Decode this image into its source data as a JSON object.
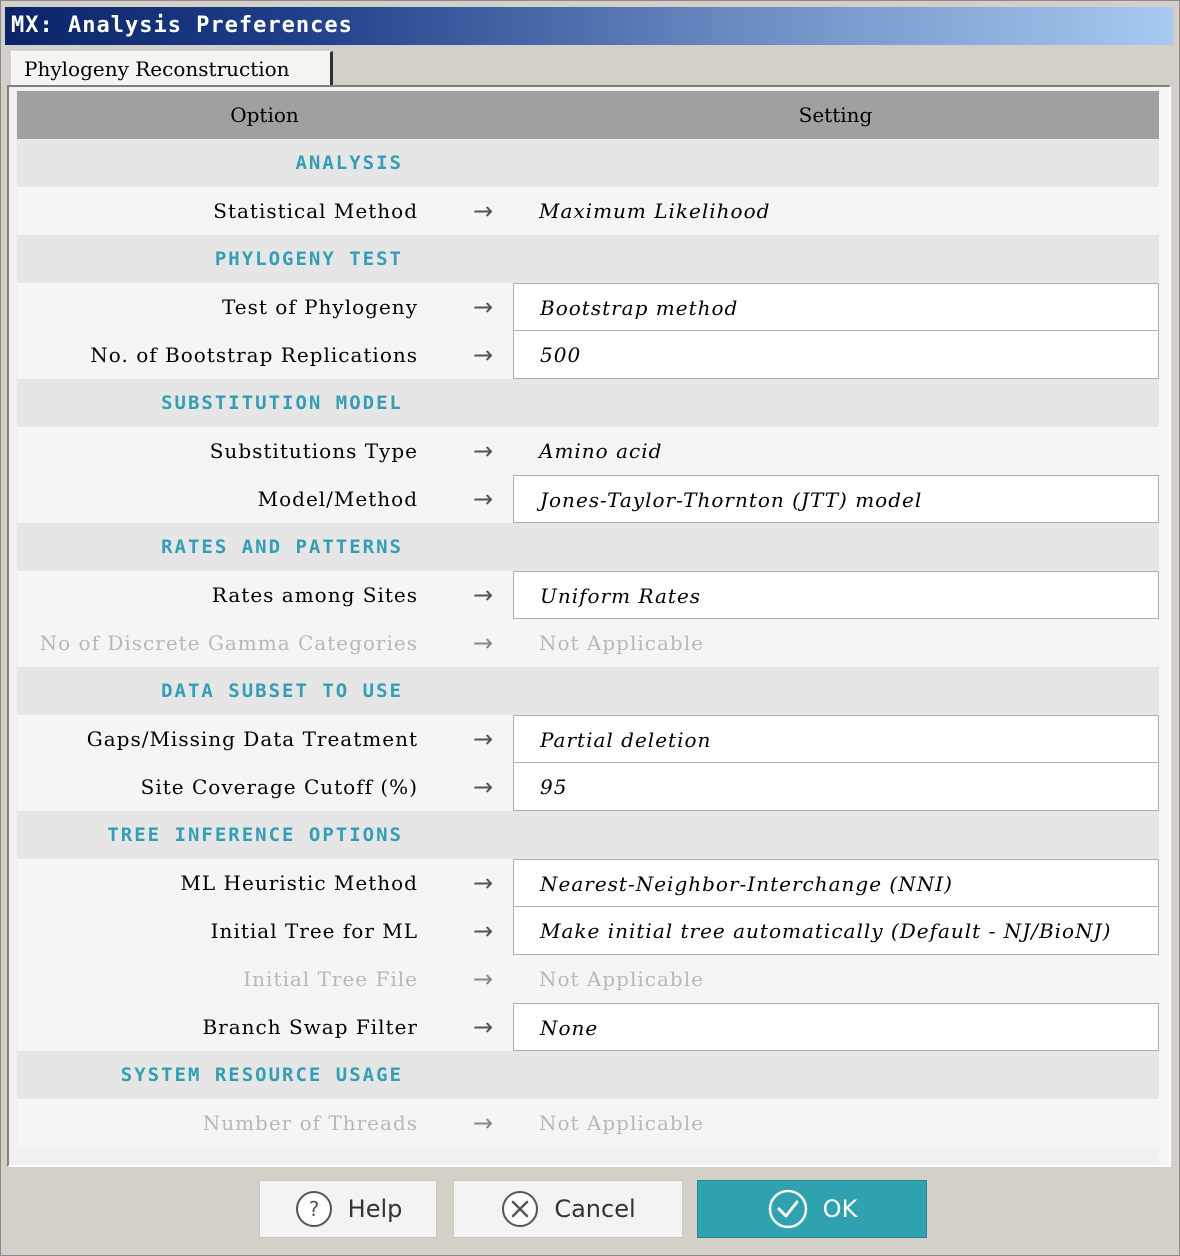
{
  "window": {
    "title": "MX: Analysis Preferences"
  },
  "tabs": [
    {
      "label": "Phylogeny Reconstruction"
    }
  ],
  "table": {
    "headers": {
      "option": "Option",
      "setting": "Setting"
    },
    "rows": [
      {
        "kind": "section",
        "label": "ANALYSIS"
      },
      {
        "kind": "item",
        "label": "Statistical Method",
        "value": "Maximum Likelihood",
        "editable": false,
        "enabled": true
      },
      {
        "kind": "section",
        "label": "PHYLOGENY TEST"
      },
      {
        "kind": "item",
        "label": "Test of Phylogeny",
        "value": "Bootstrap method",
        "editable": true,
        "enabled": true
      },
      {
        "kind": "item",
        "label": "No. of Bootstrap Replications",
        "value": "500",
        "editable": true,
        "enabled": true
      },
      {
        "kind": "section",
        "label": "SUBSTITUTION MODEL"
      },
      {
        "kind": "item",
        "label": "Substitutions Type",
        "value": "Amino acid",
        "editable": false,
        "enabled": true
      },
      {
        "kind": "item",
        "label": "Model/Method",
        "value": "Jones-Taylor-Thornton (JTT) model",
        "editable": true,
        "enabled": true
      },
      {
        "kind": "section",
        "label": "RATES AND PATTERNS"
      },
      {
        "kind": "item",
        "label": "Rates among Sites",
        "value": "Uniform Rates",
        "editable": true,
        "enabled": true
      },
      {
        "kind": "item",
        "label": "No of Discrete Gamma Categories",
        "value": "Not Applicable",
        "editable": false,
        "enabled": false
      },
      {
        "kind": "section",
        "label": "DATA SUBSET TO USE"
      },
      {
        "kind": "item",
        "label": "Gaps/Missing Data Treatment",
        "value": "Partial deletion",
        "editable": true,
        "enabled": true
      },
      {
        "kind": "item",
        "label": "Site Coverage Cutoff (%)",
        "value": "95",
        "editable": true,
        "enabled": true
      },
      {
        "kind": "section",
        "label": "TREE INFERENCE OPTIONS"
      },
      {
        "kind": "item",
        "label": "ML Heuristic Method",
        "value": "Nearest-Neighbor-Interchange (NNI)",
        "editable": true,
        "enabled": true
      },
      {
        "kind": "item",
        "label": "Initial Tree for ML",
        "value": "Make initial tree automatically (Default - NJ/BioNJ)",
        "editable": true,
        "enabled": true
      },
      {
        "kind": "item",
        "label": "Initial Tree File",
        "value": "Not Applicable",
        "editable": false,
        "enabled": false
      },
      {
        "kind": "item",
        "label": "Branch Swap Filter",
        "value": "None",
        "editable": true,
        "enabled": true
      },
      {
        "kind": "section",
        "label": "SYSTEM RESOURCE USAGE"
      },
      {
        "kind": "item",
        "label": "Number of Threads",
        "value": "Not Applicable",
        "editable": false,
        "enabled": false
      }
    ],
    "arrow": "→"
  },
  "buttons": {
    "help": {
      "label": "Help",
      "icon": "help-icon"
    },
    "cancel": {
      "label": "Cancel",
      "icon": "close-icon"
    },
    "ok": {
      "label": "OK",
      "icon": "check-icon"
    }
  },
  "colors": {
    "section": "#32a0b4",
    "primary": "#2ea2ae",
    "titlebar": "#0a246a"
  }
}
